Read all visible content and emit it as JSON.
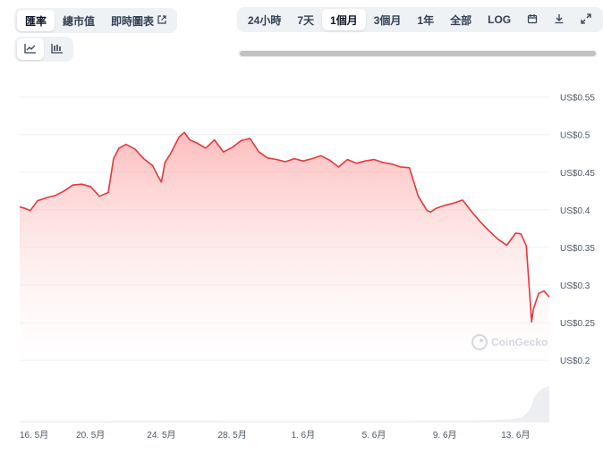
{
  "metric_tabs": [
    {
      "label": "匯率",
      "active": true
    },
    {
      "label": "總市值",
      "active": false
    },
    {
      "label": "即時圖表",
      "active": false,
      "external": true
    }
  ],
  "external_icon": "external-link-icon",
  "chart_type_buttons": [
    {
      "icon": "line-chart-icon",
      "active": true
    },
    {
      "icon": "candlestick-chart-icon",
      "active": false
    }
  ],
  "range_tabs": [
    {
      "label": "24小時",
      "active": false
    },
    {
      "label": "7天",
      "active": false
    },
    {
      "label": "1個月",
      "active": true
    },
    {
      "label": "3個月",
      "active": false
    },
    {
      "label": "1年",
      "active": false
    },
    {
      "label": "全部",
      "active": false
    },
    {
      "label": "LOG",
      "active": false
    }
  ],
  "tool_icons": [
    "calendar-icon",
    "download-icon",
    "fullscreen-icon"
  ],
  "watermark": "CoinGecko",
  "colors": {
    "line": "#e5383b",
    "fill_top": "#fecaca",
    "volume": "#eceef1",
    "grid": "#eef0f3"
  },
  "chart_data": {
    "type": "area",
    "ylim": [
      0.18,
      0.565
    ],
    "yticks": [
      "US$0.55",
      "US$0.5",
      "US$0.45",
      "US$0.4",
      "US$0.35",
      "US$0.3",
      "US$0.25",
      "US$0.2"
    ],
    "ytick_values": [
      0.55,
      0.5,
      0.45,
      0.4,
      0.35,
      0.3,
      0.25,
      0.2
    ],
    "xticks": [
      "16. 5月",
      "20. 5月",
      "24. 5月",
      "28. 5月",
      "1. 6月",
      "5. 6月",
      "9. 6月",
      "13. 6月"
    ],
    "xtick_values": [
      0,
      4,
      8,
      12,
      16,
      20,
      24,
      28
    ],
    "x": [
      0,
      0.3,
      0.6,
      1.0,
      1.5,
      2.0,
      2.5,
      3.0,
      3.5,
      4.0,
      4.5,
      5.0,
      5.3,
      5.6,
      6.0,
      6.5,
      7.0,
      7.5,
      7.8,
      8.0,
      8.2,
      8.5,
      9.0,
      9.3,
      9.6,
      10.0,
      10.5,
      11.0,
      11.5,
      12.0,
      12.5,
      13.0,
      13.5,
      14.0,
      14.5,
      15.0,
      15.5,
      16.0,
      16.5,
      17.0,
      17.5,
      18.0,
      18.5,
      19.0,
      19.5,
      20.0,
      20.5,
      21.0,
      21.5,
      22.0,
      22.5,
      23.0,
      23.2,
      23.5,
      24.0,
      24.5,
      25.0,
      25.5,
      26.0,
      26.5,
      27.0,
      27.5,
      28.0,
      28.3,
      28.6,
      28.9,
      29.0,
      29.3,
      29.6,
      29.9
    ],
    "values": [
      0.404,
      0.402,
      0.399,
      0.412,
      0.416,
      0.419,
      0.425,
      0.433,
      0.434,
      0.431,
      0.418,
      0.423,
      0.468,
      0.482,
      0.487,
      0.481,
      0.468,
      0.459,
      0.445,
      0.437,
      0.463,
      0.474,
      0.497,
      0.503,
      0.493,
      0.489,
      0.482,
      0.493,
      0.477,
      0.483,
      0.492,
      0.495,
      0.477,
      0.469,
      0.467,
      0.464,
      0.468,
      0.465,
      0.468,
      0.472,
      0.466,
      0.457,
      0.467,
      0.462,
      0.465,
      0.467,
      0.463,
      0.461,
      0.457,
      0.456,
      0.418,
      0.399,
      0.397,
      0.402,
      0.406,
      0.409,
      0.413,
      0.398,
      0.384,
      0.372,
      0.361,
      0.353,
      0.369,
      0.368,
      0.352,
      0.251,
      0.268,
      0.289,
      0.292,
      0.284
    ],
    "volume": [
      0.02,
      0.02,
      0.02,
      0.02,
      0.02,
      0.02,
      0.02,
      0.02,
      0.02,
      0.02,
      0.02,
      0.02,
      0.03,
      0.03,
      0.03,
      0.03,
      0.03,
      0.03,
      0.03,
      0.03,
      0.03,
      0.03,
      0.03,
      0.03,
      0.03,
      0.03,
      0.03,
      0.03,
      0.02,
      0.02,
      0.02,
      0.02,
      0.02,
      0.02,
      0.02,
      0.02,
      0.02,
      0.02,
      0.02,
      0.02,
      0.02,
      0.02,
      0.02,
      0.02,
      0.02,
      0.02,
      0.02,
      0.02,
      0.02,
      0.02,
      0.03,
      0.03,
      0.03,
      0.03,
      0.03,
      0.03,
      0.03,
      0.03,
      0.04,
      0.05,
      0.06,
      0.06,
      0.08,
      0.12,
      0.22,
      0.45,
      0.65,
      0.85,
      0.95,
      1.0
    ]
  }
}
